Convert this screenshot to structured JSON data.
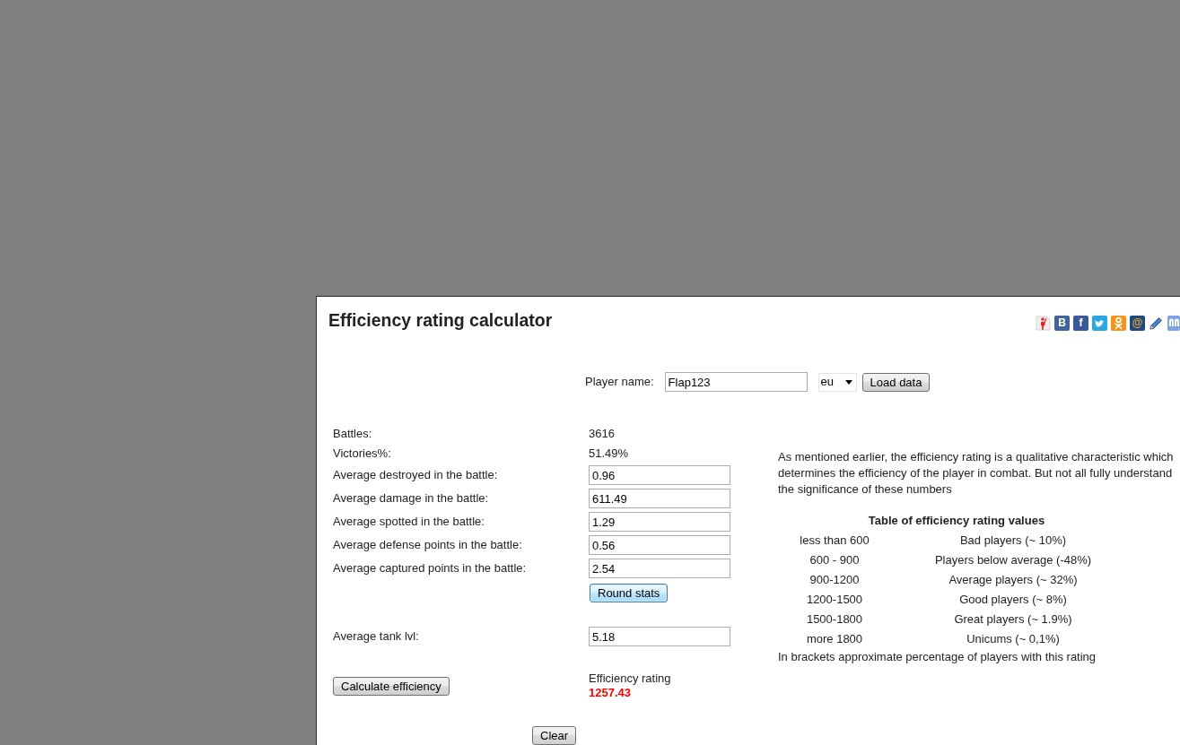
{
  "dialog": {
    "title": "Efficiency rating calculator",
    "share_icons": [
      {
        "kind": "figure"
      },
      {
        "kind": "b-tile",
        "glyph": "B"
      },
      {
        "kind": "f-tile",
        "glyph": "f"
      },
      {
        "kind": "bird-tile"
      },
      {
        "kind": "ring-figure-tile"
      },
      {
        "kind": "at-tile",
        "glyph": "@"
      },
      {
        "kind": "pencil"
      },
      {
        "kind": "partial-tile"
      }
    ],
    "player": {
      "label": "Player name:",
      "name_field": {
        "value": "Flap123"
      },
      "region_select": {
        "value": "eu"
      },
      "load_button": {
        "label": "Load data",
        "focused": false
      }
    },
    "stats": [
      {
        "kind": "text",
        "label": "Battles:",
        "value": "3616"
      },
      {
        "kind": "text",
        "label": "Victories%:",
        "value": "51.49%"
      },
      {
        "kind": "input",
        "label": "Average destroyed in the battle:",
        "value": "0.96"
      },
      {
        "kind": "input",
        "label": "Average damage in the battle:",
        "value": "611.49"
      },
      {
        "kind": "input",
        "label": "Average spotted in the battle:",
        "value": "1.29"
      },
      {
        "kind": "input",
        "label": "Average defense points in the battle:",
        "value": "0.56"
      },
      {
        "kind": "input",
        "label": "Average captured points in the battle:",
        "value": "2.54"
      }
    ],
    "round_button": {
      "label": "Round stats",
      "focused": true
    },
    "tank_level": {
      "label": "Average tank lvl:",
      "value": "5.18"
    },
    "calculate_button": {
      "label": "Calculate efficiency",
      "focused": false
    },
    "result": {
      "label": "Efficiency rating",
      "value": "1257.43"
    },
    "clear_button": {
      "label": "Clear",
      "focused": false
    },
    "info": {
      "paragraph": "As mentioned earlier, the efficiency rating is a qualitative characteristic which determines the efficiency of the player in combat. But not all fully understand the significance of these numbers",
      "table": {
        "title": "Table of efficiency rating values",
        "rows": [
          {
            "range": "less than 600",
            "description": "Bad players (~ 10%)"
          },
          {
            "range": "600 - 900",
            "description": "Players below average (-48%)"
          },
          {
            "range": "900-1200",
            "description": "Average players (~ 32%)"
          },
          {
            "range": "1200-1500",
            "description": "Good players (~ 8%)"
          },
          {
            "range": "1500-1800",
            "description": "Great players (~ 1.9%)"
          },
          {
            "range": "more 1800",
            "description": "Unicums (~ 0,1%)"
          }
        ]
      },
      "note": "In brackets approximate percentage of players with this rating"
    }
  }
}
